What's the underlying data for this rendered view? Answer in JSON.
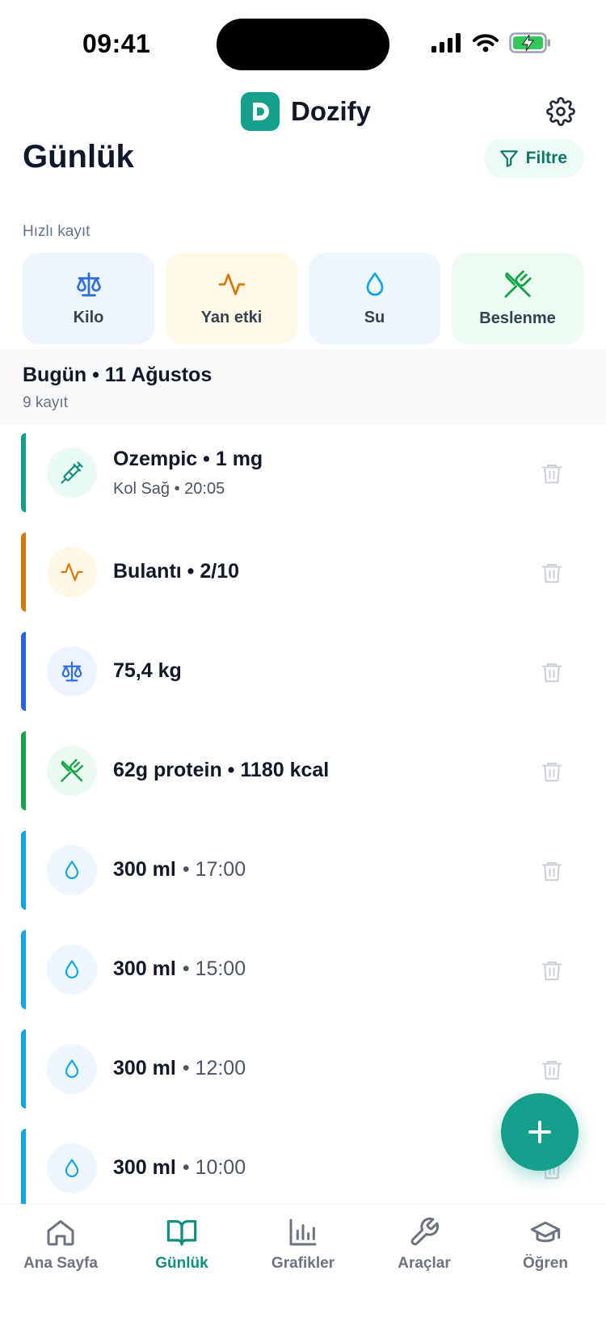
{
  "status_bar": {
    "time": "09:41"
  },
  "header": {
    "app_name": "Dozify",
    "logo_letter": "D"
  },
  "page": {
    "title": "Günlük",
    "filter_label": "Filtre"
  },
  "quick_log": {
    "label": "Hızlı kayıt",
    "items": [
      {
        "label": "Kilo",
        "icon": "scale-icon",
        "color": "#2f6fde"
      },
      {
        "label": "Yan etki",
        "icon": "pulse-icon",
        "color": "#d97706"
      },
      {
        "label": "Su",
        "icon": "water-drop-icon",
        "color": "#0ea5e9"
      },
      {
        "label": "Beslenme",
        "icon": "utensils-crossed-icon",
        "color": "#16a34a"
      }
    ]
  },
  "day": {
    "title": "Bugün • 11 Ağustos",
    "count": "9 kayıt"
  },
  "entries": [
    {
      "title": "Ozempic • 1 mg",
      "subtitle": "Kol Sağ • 20:05",
      "time": "",
      "icon": "syringe-icon",
      "accent": "#0f9f84"
    },
    {
      "title": "Bulantı • 2/10",
      "subtitle": "",
      "time": "",
      "icon": "pulse-icon",
      "accent": "#d97706"
    },
    {
      "title": "75,4 kg",
      "subtitle": "",
      "time": "",
      "icon": "scale-icon",
      "accent": "#2563eb"
    },
    {
      "title": "62g protein • 1180 kcal",
      "subtitle": "",
      "time": "",
      "icon": "utensils-crossed-icon",
      "accent": "#16a34a"
    },
    {
      "title": "300 ml",
      "subtitle": "",
      "time": "• 17:00",
      "icon": "water-drop-icon",
      "accent": "#0ea5e9"
    },
    {
      "title": "300 ml",
      "subtitle": "",
      "time": "• 15:00",
      "icon": "water-drop-icon",
      "accent": "#0ea5e9"
    },
    {
      "title": "300 ml",
      "subtitle": "",
      "time": "• 12:00",
      "icon": "water-drop-icon",
      "accent": "#0ea5e9"
    },
    {
      "title": "300 ml",
      "subtitle": "",
      "time": "• 10:00",
      "icon": "water-drop-icon",
      "accent": "#0ea5e9"
    }
  ],
  "tabs": [
    {
      "label": "Ana Sayfa",
      "icon": "home-icon",
      "active": false
    },
    {
      "label": "Günlük",
      "icon": "book-icon",
      "active": true
    },
    {
      "label": "Grafikler",
      "icon": "bar-chart-icon",
      "active": false
    },
    {
      "label": "Araçlar",
      "icon": "wrench-icon",
      "active": false
    },
    {
      "label": "Öğren",
      "icon": "graduation-cap-icon",
      "active": false
    }
  ],
  "colors": {
    "brand": "#15a08b",
    "active_tab": "#0f8f7c"
  }
}
